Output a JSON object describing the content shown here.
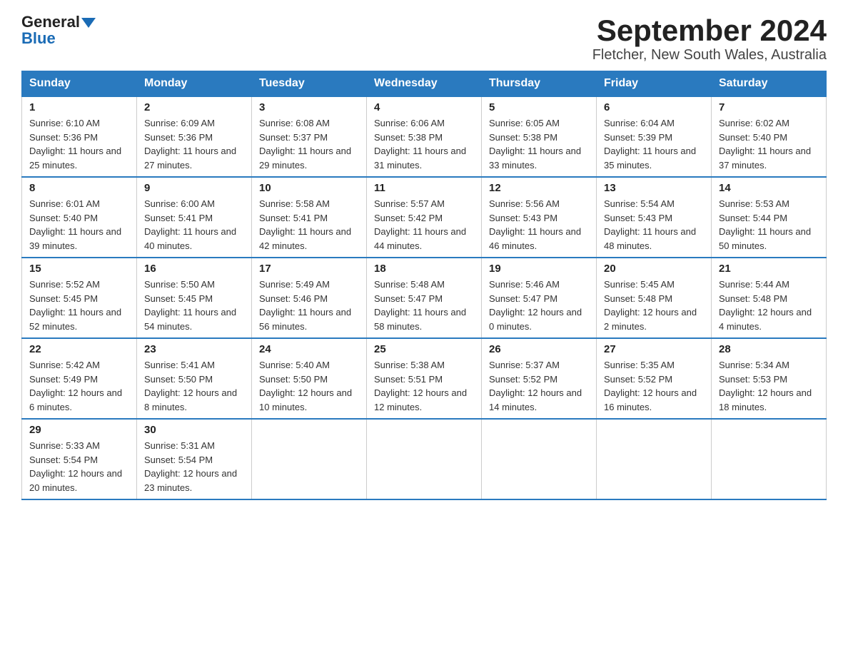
{
  "header": {
    "logo_general": "General",
    "logo_blue": "Blue",
    "month_title": "September 2024",
    "location": "Fletcher, New South Wales, Australia"
  },
  "days_of_week": [
    "Sunday",
    "Monday",
    "Tuesday",
    "Wednesday",
    "Thursday",
    "Friday",
    "Saturday"
  ],
  "weeks": [
    [
      {
        "day": "1",
        "sunrise": "6:10 AM",
        "sunset": "5:36 PM",
        "daylight": "11 hours and 25 minutes."
      },
      {
        "day": "2",
        "sunrise": "6:09 AM",
        "sunset": "5:36 PM",
        "daylight": "11 hours and 27 minutes."
      },
      {
        "day": "3",
        "sunrise": "6:08 AM",
        "sunset": "5:37 PM",
        "daylight": "11 hours and 29 minutes."
      },
      {
        "day": "4",
        "sunrise": "6:06 AM",
        "sunset": "5:38 PM",
        "daylight": "11 hours and 31 minutes."
      },
      {
        "day": "5",
        "sunrise": "6:05 AM",
        "sunset": "5:38 PM",
        "daylight": "11 hours and 33 minutes."
      },
      {
        "day": "6",
        "sunrise": "6:04 AM",
        "sunset": "5:39 PM",
        "daylight": "11 hours and 35 minutes."
      },
      {
        "day": "7",
        "sunrise": "6:02 AM",
        "sunset": "5:40 PM",
        "daylight": "11 hours and 37 minutes."
      }
    ],
    [
      {
        "day": "8",
        "sunrise": "6:01 AM",
        "sunset": "5:40 PM",
        "daylight": "11 hours and 39 minutes."
      },
      {
        "day": "9",
        "sunrise": "6:00 AM",
        "sunset": "5:41 PM",
        "daylight": "11 hours and 40 minutes."
      },
      {
        "day": "10",
        "sunrise": "5:58 AM",
        "sunset": "5:41 PM",
        "daylight": "11 hours and 42 minutes."
      },
      {
        "day": "11",
        "sunrise": "5:57 AM",
        "sunset": "5:42 PM",
        "daylight": "11 hours and 44 minutes."
      },
      {
        "day": "12",
        "sunrise": "5:56 AM",
        "sunset": "5:43 PM",
        "daylight": "11 hours and 46 minutes."
      },
      {
        "day": "13",
        "sunrise": "5:54 AM",
        "sunset": "5:43 PM",
        "daylight": "11 hours and 48 minutes."
      },
      {
        "day": "14",
        "sunrise": "5:53 AM",
        "sunset": "5:44 PM",
        "daylight": "11 hours and 50 minutes."
      }
    ],
    [
      {
        "day": "15",
        "sunrise": "5:52 AM",
        "sunset": "5:45 PM",
        "daylight": "11 hours and 52 minutes."
      },
      {
        "day": "16",
        "sunrise": "5:50 AM",
        "sunset": "5:45 PM",
        "daylight": "11 hours and 54 minutes."
      },
      {
        "day": "17",
        "sunrise": "5:49 AM",
        "sunset": "5:46 PM",
        "daylight": "11 hours and 56 minutes."
      },
      {
        "day": "18",
        "sunrise": "5:48 AM",
        "sunset": "5:47 PM",
        "daylight": "11 hours and 58 minutes."
      },
      {
        "day": "19",
        "sunrise": "5:46 AM",
        "sunset": "5:47 PM",
        "daylight": "12 hours and 0 minutes."
      },
      {
        "day": "20",
        "sunrise": "5:45 AM",
        "sunset": "5:48 PM",
        "daylight": "12 hours and 2 minutes."
      },
      {
        "day": "21",
        "sunrise": "5:44 AM",
        "sunset": "5:48 PM",
        "daylight": "12 hours and 4 minutes."
      }
    ],
    [
      {
        "day": "22",
        "sunrise": "5:42 AM",
        "sunset": "5:49 PM",
        "daylight": "12 hours and 6 minutes."
      },
      {
        "day": "23",
        "sunrise": "5:41 AM",
        "sunset": "5:50 PM",
        "daylight": "12 hours and 8 minutes."
      },
      {
        "day": "24",
        "sunrise": "5:40 AM",
        "sunset": "5:50 PM",
        "daylight": "12 hours and 10 minutes."
      },
      {
        "day": "25",
        "sunrise": "5:38 AM",
        "sunset": "5:51 PM",
        "daylight": "12 hours and 12 minutes."
      },
      {
        "day": "26",
        "sunrise": "5:37 AM",
        "sunset": "5:52 PM",
        "daylight": "12 hours and 14 minutes."
      },
      {
        "day": "27",
        "sunrise": "5:35 AM",
        "sunset": "5:52 PM",
        "daylight": "12 hours and 16 minutes."
      },
      {
        "day": "28",
        "sunrise": "5:34 AM",
        "sunset": "5:53 PM",
        "daylight": "12 hours and 18 minutes."
      }
    ],
    [
      {
        "day": "29",
        "sunrise": "5:33 AM",
        "sunset": "5:54 PM",
        "daylight": "12 hours and 20 minutes."
      },
      {
        "day": "30",
        "sunrise": "5:31 AM",
        "sunset": "5:54 PM",
        "daylight": "12 hours and 23 minutes."
      },
      null,
      null,
      null,
      null,
      null
    ]
  ],
  "labels": {
    "sunrise": "Sunrise:",
    "sunset": "Sunset:",
    "daylight": "Daylight:"
  }
}
